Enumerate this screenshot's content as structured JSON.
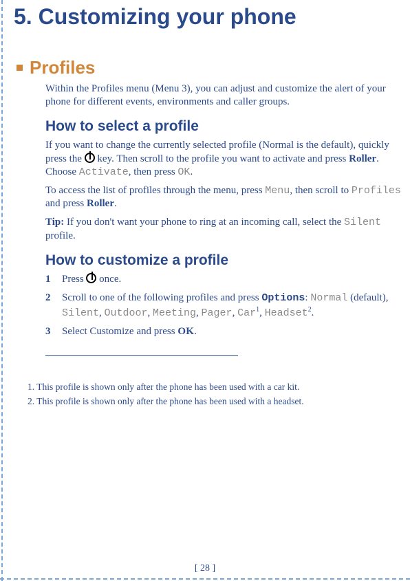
{
  "chapter_title": "5. Customizing your phone",
  "section": {
    "title": "Profiles",
    "intro": "Within the Profiles menu (Menu 3), you can adjust and customize the alert of your phone for different events, environments and caller groups."
  },
  "howto_select": {
    "heading": "How to select a profile",
    "p1_a": "If you want to change the currently selected profile (Normal is the default), quickly press the ",
    "p1_b": " key. Then scroll to the profile you want to activate and press ",
    "p1_roller": "Roller",
    "p1_c": ". Choose ",
    "p1_activate": "Activate",
    "p1_d": ", then press ",
    "p1_ok": "OK",
    "p1_e": ".",
    "p2_a": "To access the list of profiles through the menu, press ",
    "p2_menu": "Menu",
    "p2_b": ", then scroll to ",
    "p2_profiles": "Profiles",
    "p2_c": " and press ",
    "p2_roller": "Roller",
    "p2_d": ".",
    "tip_label": "Tip:",
    "tip_a": " If you don't want your phone to ring at an incoming call, select the ",
    "tip_silent": "Silent",
    "tip_b": " profile."
  },
  "howto_customize": {
    "heading": "How to customize a profile",
    "step1_num": "1",
    "step1_a": "Press ",
    "step1_b": " once.",
    "step2_num": "2",
    "step2_a": "Scroll to one of the following profiles and press ",
    "step2_options": "Options",
    "step2_colon": ":  ",
    "step2_normal": "Normal",
    "step2_default": " (default), ",
    "step2_silent": "Silent",
    "step2_c1": ", ",
    "step2_outdoor": "Outdoor",
    "step2_c2": ", ",
    "step2_meeting": "Meeting",
    "step2_c3": ", ",
    "step2_pager": "Pager",
    "step2_c4": ", ",
    "step2_car": "Car",
    "step2_sup1": "1",
    "step2_c5": ", ",
    "step2_headset": "Headset",
    "step2_sup2": "2",
    "step2_end": ".",
    "step3_num": "3",
    "step3_a": "Select ",
    "step3_customize": "Customize",
    "step3_b": " and press ",
    "step3_ok": "OK",
    "step3_c": "."
  },
  "footnotes": {
    "fn1": "1.   This profile is shown only after the phone has been used with a car kit.",
    "fn2": "2.   This profile is shown only after the phone has been used with a headset."
  },
  "page_number": "[ 28 ]"
}
